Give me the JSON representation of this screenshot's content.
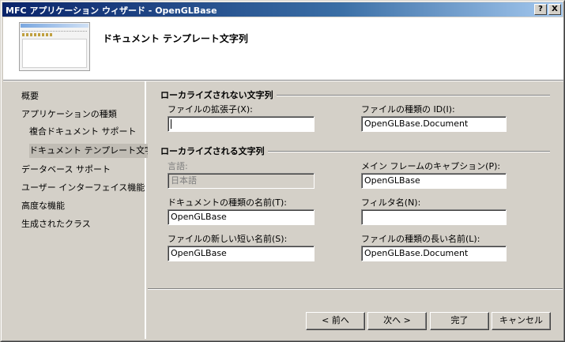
{
  "window": {
    "title": "MFC アプリケーション ウィザード - OpenGLBase",
    "help_button": "?",
    "close_button": "X"
  },
  "banner": {
    "title": "ドキュメント テンプレート文字列"
  },
  "nav": {
    "items": [
      {
        "label": "概要"
      },
      {
        "label": "アプリケーションの種類"
      },
      {
        "label": "複合ドキュメント サポート"
      },
      {
        "label": "ドキュメント テンプレート文字列"
      },
      {
        "label": "データベース サポート"
      },
      {
        "label": "ユーザー インターフェイス機能"
      },
      {
        "label": "高度な機能"
      },
      {
        "label": "生成されたクラス"
      }
    ]
  },
  "groups": {
    "non_localized": "ローカライズされない文字列",
    "localized": "ローカライズされる文字列"
  },
  "fields": {
    "file_ext": {
      "label": "ファイルの拡張子(X):",
      "value": ""
    },
    "file_type_id": {
      "label": "ファイルの種類の ID(I):",
      "value": "OpenGLBase.Document"
    },
    "language": {
      "label": "言語:",
      "value": "日本語"
    },
    "main_frame_caption": {
      "label": "メイン フレームのキャプション(P):",
      "value": "OpenGLBase"
    },
    "doc_type_name": {
      "label": "ドキュメントの種類の名前(T):",
      "value": "OpenGLBase"
    },
    "filter_name": {
      "label": "フィルタ名(N):",
      "value": ""
    },
    "file_new_short_name": {
      "label": "ファイルの新しい短い名前(S):",
      "value": "OpenGLBase"
    },
    "file_type_long_name": {
      "label": "ファイルの種類の長い名前(L):",
      "value": "OpenGLBase.Document"
    }
  },
  "buttons": {
    "back": "< 前へ",
    "next": "次へ >",
    "finish": "完了",
    "cancel": "キャンセル"
  }
}
